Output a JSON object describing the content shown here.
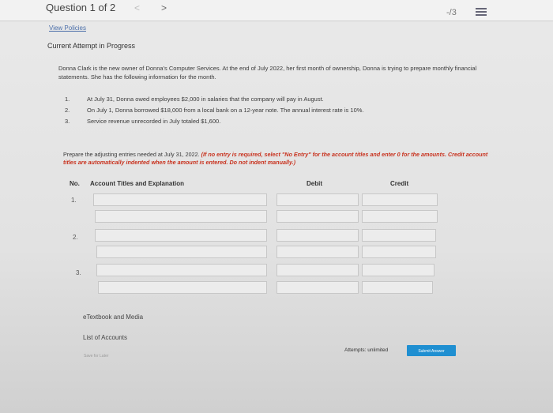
{
  "header": {
    "question_label": "Question 1 of 2",
    "prev_glyph": "<",
    "next_glyph": ">",
    "score": "-/3"
  },
  "links": {
    "view_policies": "View Policies"
  },
  "attempt_status": "Current Attempt in Progress",
  "intro": "Donna Clark is the new owner of Donna's Computer Services. At the end of July 2022, her first month of ownership, Donna is trying to prepare monthly financial statements. She has the following information for the month.",
  "items": [
    {
      "num": "1.",
      "text": "At July 31, Donna owed employees $2,000 in salaries that the company will pay in August."
    },
    {
      "num": "2.",
      "text": "On July 1, Donna borrowed $18,000 from a local bank on a 12-year note. The annual interest rate is 10%."
    },
    {
      "num": "3.",
      "text": "Service revenue unrecorded in July totaled $1,600."
    }
  ],
  "prompt": {
    "text": "Prepare the adjusting entries needed at July 31, 2022.",
    "warning": "(If no entry is required, select \"No Entry\" for the account titles and enter 0 for the amounts. Credit account titles are automatically indented when the amount is entered. Do not indent manually.)"
  },
  "table": {
    "headers": {
      "no": "No.",
      "account": "Account Titles and Explanation",
      "debit": "Debit",
      "credit": "Credit"
    },
    "entries": [
      {
        "num": "1."
      },
      {
        "num": "2."
      },
      {
        "num": "3."
      }
    ]
  },
  "footer": {
    "etextbook": "eTextbook and Media",
    "list_of_accounts": "List of Accounts",
    "save_for_later": "Save for Later",
    "attempts": "Attempts: unlimited",
    "submit": "Submit Answer"
  }
}
